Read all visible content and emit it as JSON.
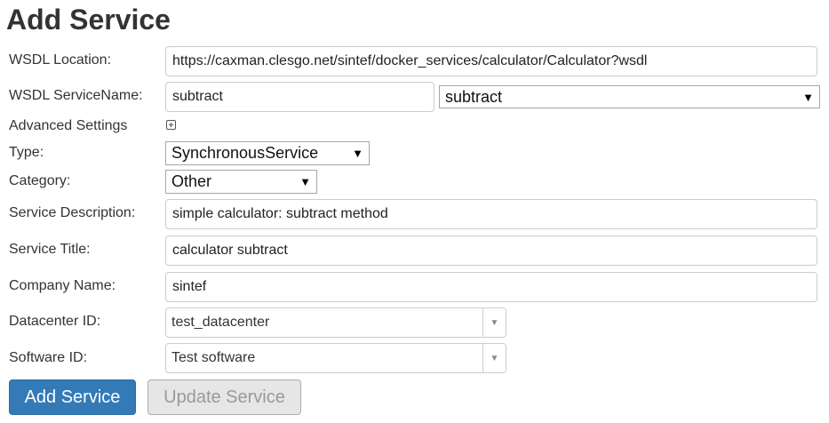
{
  "page": {
    "title": "Add Service"
  },
  "form": {
    "wsdl_location": {
      "label": "WSDL Location:",
      "value": "https://caxman.clesgo.net/sintef/docker_services/calculator/Calculator?wsdl"
    },
    "wsdl_service_name": {
      "label": "WSDL ServiceName:",
      "value": "subtract",
      "select_value": "subtract"
    },
    "advanced_settings": {
      "label": "Advanced Settings"
    },
    "type": {
      "label": "Type:",
      "value": "SynchronousService"
    },
    "category": {
      "label": "Category:",
      "value": "Other"
    },
    "service_description": {
      "label": "Service Description:",
      "value": "simple calculator: subtract method"
    },
    "service_title": {
      "label": "Service Title:",
      "value": "calculator subtract"
    },
    "company_name": {
      "label": "Company Name:",
      "value": "sintef"
    },
    "datacenter_id": {
      "label": "Datacenter ID:",
      "value": "test_datacenter"
    },
    "software_id": {
      "label": "Software ID:",
      "value": "Test software"
    }
  },
  "buttons": {
    "add": "Add Service",
    "update": "Update Service"
  },
  "icons": {
    "expand": "plus-square-icon",
    "dropdown": "caret-down-icon"
  },
  "colors": {
    "primary": "#337ab7",
    "disabled": "#e6e6e6"
  }
}
